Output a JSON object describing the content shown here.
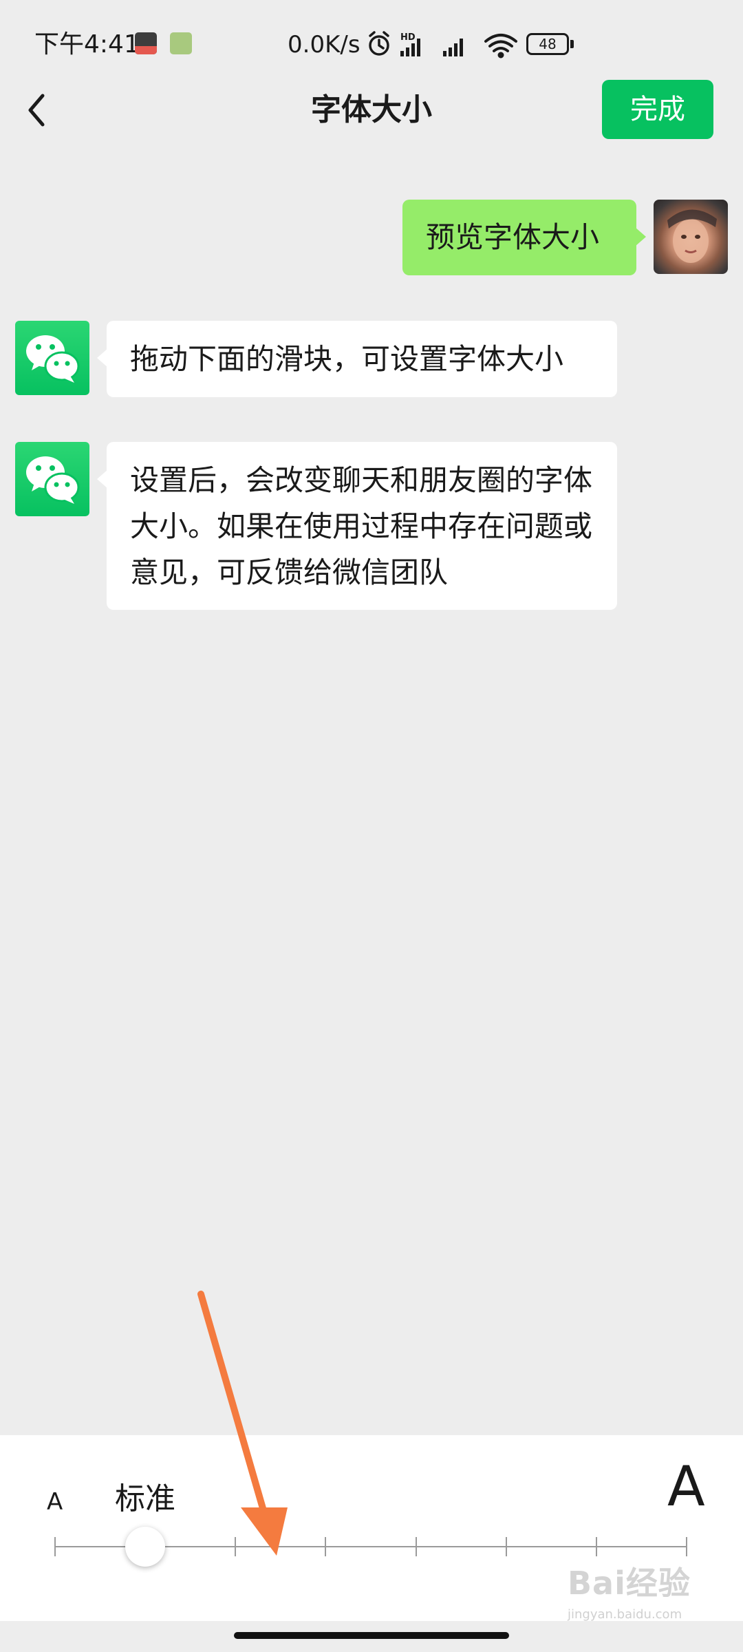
{
  "status_bar": {
    "time": "下午4:41",
    "network_speed": "0.0K/s",
    "hd_label": "HD",
    "battery": "48",
    "app_icons": [
      "qq-icon",
      "app-notification-icon"
    ],
    "system_icons": [
      "alarm-icon",
      "signal-hd-icon",
      "signal-icon",
      "wifi-icon",
      "battery-icon"
    ]
  },
  "nav": {
    "back_icon": "chevron-left-icon",
    "title": "字体大小",
    "done_label": "完成",
    "done_color": "#07c160"
  },
  "chat": {
    "outgoing": {
      "text": "预览字体大小",
      "bubble_color": "#95ec69"
    },
    "incoming": [
      {
        "text": "拖动下面的滑块，可设置字体大小"
      },
      {
        "text": "设置后，会改变聊天和朋友圈的字体大小。如果在使用过程中存在问题或意见，可反馈给微信团队"
      }
    ],
    "bot_avatar_icon": "wechat-logo-icon",
    "bot_avatar_color": "#07c160",
    "background_color": "#ededed"
  },
  "font_panel": {
    "small_label": "A",
    "large_label": "A",
    "current_label": "标准",
    "slider": {
      "positions": 8,
      "selected_index": 1
    }
  },
  "annotation": {
    "arrow_color": "#f47b3f"
  },
  "watermark": {
    "text": "Bai经验",
    "url": "jingyan.baidu.com"
  }
}
